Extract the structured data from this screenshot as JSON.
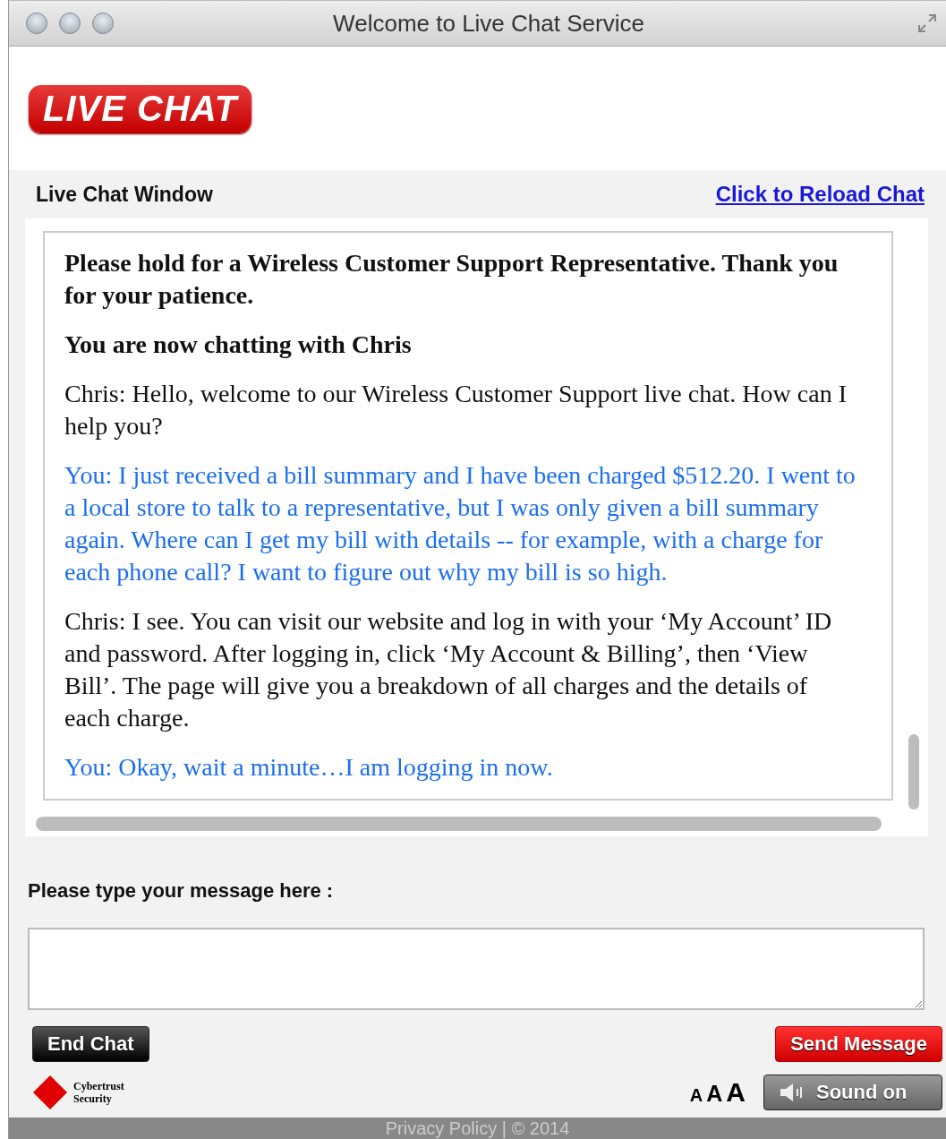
{
  "window": {
    "title": "Welcome to Live Chat Service"
  },
  "logo": {
    "text": "LIVE CHAT"
  },
  "header": {
    "title": "Live Chat Window",
    "reload_link": "Click to Reload Chat"
  },
  "transcript": [
    {
      "kind": "system",
      "text": "Please hold for a Wireless Customer Support Representative. Thank you for your patience."
    },
    {
      "kind": "system",
      "text": "You are now chatting with Chris"
    },
    {
      "kind": "agent",
      "text": "Chris: Hello, welcome to our Wireless Customer Support live chat. How can I help you?"
    },
    {
      "kind": "user",
      "text": "You: I just received a bill summary and I have been charged $512.20. I went to a local store to talk to a representative, but I was only given a bill summary again. Where can I get my bill with details -- for example, with a charge for each phone call? I want to figure out why my bill is so high."
    },
    {
      "kind": "agent",
      "text": "Chris: I see. You can visit our website and log in with your ‘My Account’ ID and password. After logging in, click ‘My Account & Billing’, then ‘View Bill’. The page will give you a breakdown of all charges and the details of each charge."
    },
    {
      "kind": "user",
      "text": "You: Okay, wait a minute…I am logging in now."
    }
  ],
  "composer": {
    "label": "Please type your message here :"
  },
  "buttons": {
    "end_chat": "End Chat",
    "send": "Send Message",
    "sound": "Sound on"
  },
  "security_badge": {
    "line_1": "Cybertrust",
    "line_2": "Security"
  },
  "font_sizes": [
    "A",
    "A",
    "A"
  ],
  "footer": {
    "text": "Privacy Policy | © 2014"
  }
}
